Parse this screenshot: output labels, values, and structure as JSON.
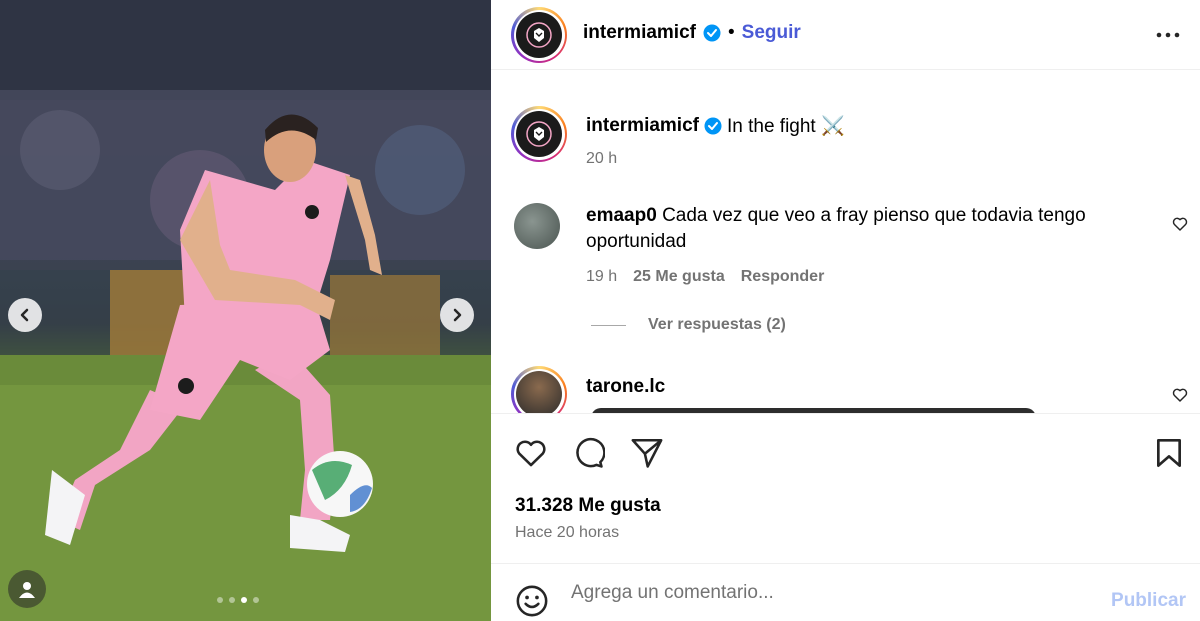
{
  "post": {
    "author": "intermiamicf",
    "follow_label": "Seguir",
    "separator": "•",
    "caption": "In the fight ⚔️",
    "caption_age": "20 h",
    "carousel": {
      "slides": 4,
      "active_index": 2
    }
  },
  "comments": [
    {
      "username": "emaap0",
      "text": "Cada vez que veo a fray pienso que todavia tengo oportunidad",
      "age": "19 h",
      "likes": "25 Me gusta",
      "reply_label": "Responder",
      "view_replies": "Ver respuestas (2)"
    },
    {
      "username": "tarone.lc"
    }
  ],
  "stats": {
    "likes": "31.328 Me gusta",
    "posted": "Hace 20 horas"
  },
  "composer": {
    "placeholder": "Agrega un comentario...",
    "publish_label": "Publicar"
  },
  "colors": {
    "accent_link": "#4a5ad6",
    "verified": "#0095f6",
    "muted": "#737373",
    "kit_pink": "#f4a6c6"
  }
}
